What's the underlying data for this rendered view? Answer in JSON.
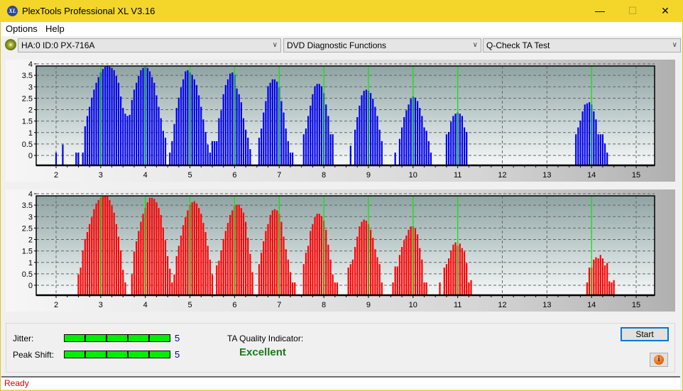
{
  "window": {
    "title": "PlexTools Professional XL V3.16",
    "app_icon": "xl-logo-icon",
    "buttons": {
      "minimize": "—",
      "maximize": "☐",
      "close": "✕"
    }
  },
  "menu": [
    "Options",
    "Help"
  ],
  "toolbar": {
    "drive": "HA:0 ID:0  PX-716A",
    "function": "DVD Diagnostic Functions",
    "test": "Q-Check TA Test",
    "chevron": "∨"
  },
  "colors": {
    "titlebar": "#f4d62a",
    "top_bars": "#0000ee",
    "bottom_bars": "#ff0000",
    "marker_lines": "#00ee00",
    "meter": "#00ee00",
    "excellent": "#1a7a1a",
    "status": "#e00000"
  },
  "chart_data": [
    {
      "type": "bar",
      "name": "top-chart",
      "xlim": [
        1.6,
        15.4
      ],
      "ylim": [
        -0.15,
        4.2
      ],
      "xticks": [
        2,
        3,
        4,
        5,
        6,
        7,
        8,
        9,
        10,
        11,
        12,
        13,
        14,
        15
      ],
      "yticks": [
        0,
        0.5,
        1,
        1.5,
        2,
        2.5,
        3,
        3.5,
        4
      ],
      "ytick_labels": [
        "0",
        "0.5",
        "1",
        "1.5",
        "2",
        "2.5",
        "3",
        "3.5",
        "4"
      ],
      "marker_x": [
        3,
        4,
        5,
        6,
        7,
        8,
        9,
        10,
        11,
        14
      ],
      "grid": true,
      "series": [
        {
          "start": 2.0,
          "values": [
            0
          ]
        },
        {
          "start": 2.15,
          "values": [
            0.35
          ]
        },
        {
          "start": 2.45,
          "values": [
            0,
            0
          ]
        },
        {
          "start": 2.6,
          "values": [
            0,
            1.15,
            1.6,
            2.0,
            2.4,
            2.75,
            3.05,
            3.3,
            3.5,
            3.65,
            3.75,
            3.8,
            3.75,
            3.7,
            3.6,
            3.35,
            3.05,
            2.45,
            1.95,
            1.7,
            1.6,
            1.65,
            2.3,
            2.75,
            3.05,
            3.35,
            3.6,
            3.7,
            3.75,
            3.7,
            3.55,
            3.3,
            3.05,
            2.5,
            2.0,
            1.5,
            0.95,
            0.65
          ]
        },
        {
          "start": 4.55,
          "values": [
            0,
            0.5,
            1.25,
            1.95,
            2.4,
            2.85,
            3.2,
            3.55,
            3.6,
            3.5,
            3.4,
            3.2,
            2.95,
            2.5,
            2.0,
            1.45,
            0.9,
            0.35,
            0,
            0.5
          ]
        },
        {
          "start": 5.55,
          "values": [
            0.5,
            0.5,
            1.5,
            1.85,
            2.55,
            2.95,
            3.2,
            3.45,
            3.5,
            3.4,
            2.8,
            2.55,
            2.2,
            1.5,
            1.0,
            0.65,
            0.15
          ]
        },
        {
          "start": 6.55,
          "values": [
            0.65,
            1.05,
            1.75,
            2.25,
            2.9,
            3.05,
            3.2,
            3.2,
            3.1,
            2.85,
            2.25,
            1.75,
            1.05,
            0.5,
            0,
            0
          ]
        },
        {
          "start": 7.55,
          "values": [
            0.8,
            1.05,
            1.6,
            2.05,
            2.55,
            2.9,
            3.0,
            3.0,
            2.9,
            2.6,
            2.1,
            1.6,
            0.8,
            0.8
          ]
        },
        {
          "start": 8.6,
          "values": [
            0.3
          ]
        },
        {
          "start": 8.7,
          "values": [
            1.0,
            1.55,
            2.05,
            2.5,
            2.7,
            2.75,
            2.7,
            2.6,
            2.35,
            2.0,
            1.6,
            1.0,
            0.5
          ]
        },
        {
          "start": 9.6,
          "values": [
            0
          ]
        },
        {
          "start": 9.7,
          "values": [
            0.6,
            1.1,
            1.55,
            1.85,
            2.1,
            2.35,
            2.45,
            2.4,
            2.25,
            1.95,
            1.6,
            1.1,
            0.95,
            0.5,
            0
          ]
        },
        {
          "start": 10.75,
          "values": [
            0.8,
            0.9,
            1.35,
            1.6,
            1.7,
            1.75,
            1.7,
            1.6,
            1.1,
            0.9
          ]
        },
        {
          "start": 13.65,
          "values": [
            0.8,
            1.1,
            1.4,
            1.8,
            2.1,
            2.15,
            2.2,
            2.1,
            1.8,
            1.45,
            0.8,
            0.8,
            0.8,
            0.4,
            0
          ]
        }
      ],
      "bar_color": "#0000ee"
    },
    {
      "type": "bar",
      "name": "bottom-chart",
      "xlim": [
        1.6,
        15.4
      ],
      "ylim": [
        -0.15,
        4.2
      ],
      "xticks": [
        2,
        3,
        4,
        5,
        6,
        7,
        8,
        9,
        10,
        11,
        12,
        13,
        14,
        15
      ],
      "yticks": [
        0,
        0.5,
        1,
        1.5,
        2,
        2.5,
        3,
        3.5,
        4
      ],
      "ytick_labels": [
        "0",
        "0.5",
        "1",
        "1.5",
        "2",
        "2.5",
        "3",
        "3.5",
        "4"
      ],
      "marker_x": [
        3,
        4,
        5,
        6,
        7,
        8,
        9,
        10,
        11,
        14
      ],
      "grid": true,
      "series": [
        {
          "start": 2.5,
          "values": [
            0.35,
            0.65,
            1.4,
            1.9,
            2.2,
            2.55,
            2.85,
            3.2,
            3.45,
            3.6,
            3.7,
            3.75,
            3.8,
            3.75,
            3.6,
            3.35,
            3.05,
            2.55,
            2.0,
            1.4,
            0.55,
            0
          ]
        },
        {
          "start": 3.7,
          "values": [
            0.35,
            1.35,
            1.8,
            2.25,
            2.65,
            3.0,
            3.25,
            3.5,
            3.7,
            3.7,
            3.65,
            3.5,
            3.25,
            2.95,
            2.4,
            1.85,
            1.15,
            0.6,
            0,
            0.35
          ]
        },
        {
          "start": 4.7,
          "values": [
            1.15,
            1.6,
            2.05,
            2.5,
            2.85,
            3.15,
            3.4,
            3.5,
            3.55,
            3.45,
            3.25,
            3.0,
            2.6,
            2.2,
            1.6,
            1.0,
            0.35
          ]
        },
        {
          "start": 5.6,
          "values": [
            0.75,
            0.95,
            1.4,
            1.9,
            2.25,
            2.6,
            2.95,
            3.15,
            3.35,
            3.4,
            3.4,
            3.25,
            3.05,
            2.65,
            1.95,
            1.25,
            0.45
          ]
        },
        {
          "start": 6.55,
          "values": [
            0.8,
            1.3,
            1.8,
            2.25,
            2.55,
            2.95,
            3.15,
            3.2,
            3.15,
            3.0,
            2.65,
            2.0,
            1.45,
            1.0,
            0.45,
            0,
            0
          ]
        },
        {
          "start": 7.55,
          "values": [
            0.8,
            1.3,
            1.6,
            2.25,
            2.55,
            2.85,
            3.0,
            3.0,
            2.9,
            2.7,
            2.3,
            1.65,
            1.0,
            0.35,
            0,
            0
          ]
        },
        {
          "start": 8.55,
          "values": [
            0.65,
            0.8,
            1.0,
            1.55,
            2.0,
            2.45,
            2.65,
            2.75,
            2.7,
            2.55,
            2.3,
            1.95,
            1.45,
            1.1,
            0.8,
            0
          ]
        },
        {
          "start": 9.55,
          "values": [
            0,
            0.7,
            0.7,
            1.2,
            1.55,
            1.85,
            2.05,
            2.3,
            2.45,
            2.45,
            2.35,
            2.1,
            1.5,
            1.0,
            0,
            0
          ]
        },
        {
          "start": 10.6,
          "values": [
            0
          ]
        },
        {
          "start": 10.7,
          "values": [
            0.65,
            0.8,
            1.05,
            1.4,
            1.65,
            1.75,
            1.6,
            1.7,
            1.5,
            1.35,
            0.85,
            0,
            0.1
          ]
        },
        {
          "start": 13.9,
          "values": [
            0,
            0.65,
            0.65,
            1.0,
            1.1,
            1.05,
            1.2,
            1.05,
            0.75,
            0.85,
            0.05,
            0,
            0.1
          ]
        }
      ],
      "bar_color": "#ff0000"
    }
  ],
  "quality": {
    "jitter_label": "Jitter:",
    "jitter_value": "5",
    "jitter_level": 5,
    "peak_shift_label": "Peak Shift:",
    "peak_shift_value": "5",
    "peak_shift_level": 5,
    "max_level": 5,
    "ta_label": "TA Quality Indicator:",
    "ta_value": "Excellent"
  },
  "buttons": {
    "start": "Start",
    "info": "i"
  },
  "status": "Ready"
}
